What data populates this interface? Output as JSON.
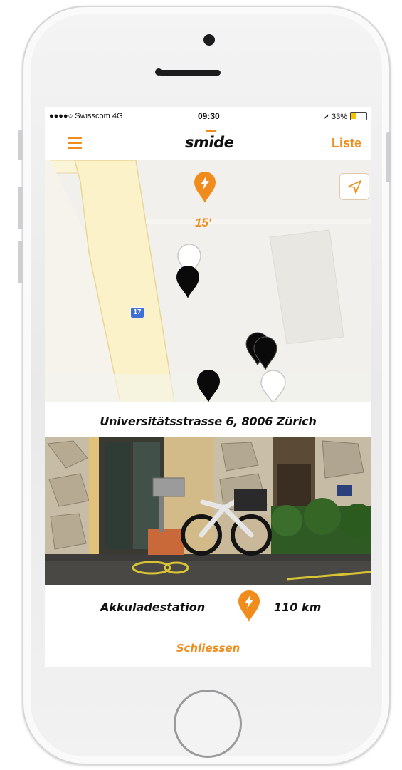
{
  "status_bar": {
    "carrier": "●●●●○ Swisscom  4G",
    "time": "09:30",
    "battery": "➚ 33%",
    "battery_level": 0.33
  },
  "nav": {
    "logo": "smide",
    "list_button": "Liste"
  },
  "map": {
    "charging_station_minutes": "15'",
    "road_label": "17",
    "markers": [
      "black",
      "white",
      "black",
      "black",
      "black",
      "white"
    ]
  },
  "station": {
    "address": "Universitätsstrasse 6, 8006 Zürich",
    "type_label": "Akkuladestation",
    "range": "110 km"
  },
  "actions": {
    "close_button": "Schliessen"
  },
  "colors": {
    "accent": "#f08c1c",
    "map_road": "#fbf2c9",
    "road_shield": "#3d6fd6"
  }
}
